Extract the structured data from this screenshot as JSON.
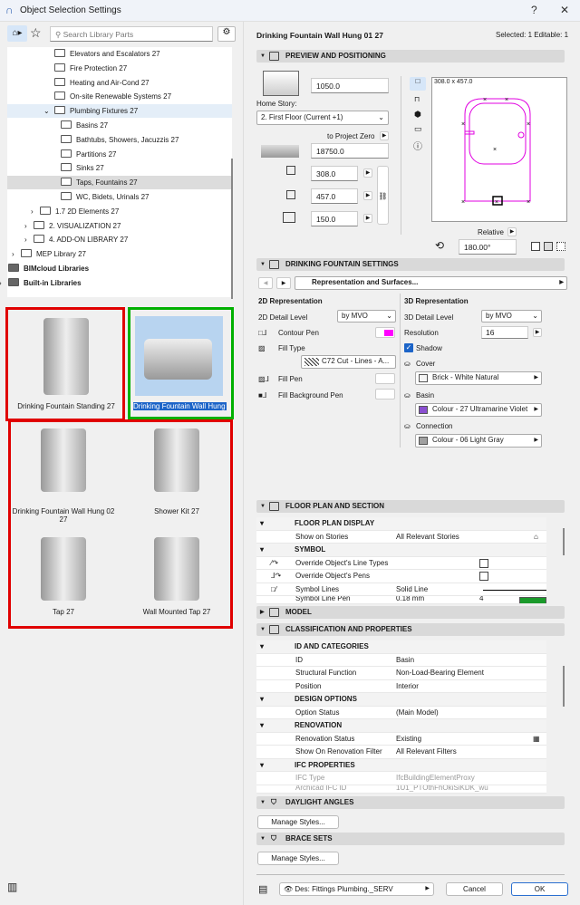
{
  "window": {
    "title": "Object Selection Settings",
    "help": "?",
    "close": "✕"
  },
  "search": {
    "placeholder": "Search Library Parts"
  },
  "tree": [
    {
      "label": "Elevators and Escalators 27",
      "level": 3
    },
    {
      "label": "Fire Protection 27",
      "level": 3
    },
    {
      "label": "Heating and Air-Cond 27",
      "level": 3
    },
    {
      "label": "On-site Renewable Systems 27",
      "level": 3
    },
    {
      "label": "Plumbing Fixtures 27",
      "level": 3,
      "expanded": true,
      "selected": true
    },
    {
      "label": "Basins 27",
      "level": 4
    },
    {
      "label": "Bathtubs, Showers, Jacuzzis 27",
      "level": 4
    },
    {
      "label": "Partitions 27",
      "level": 4
    },
    {
      "label": "Sinks 27",
      "level": 4
    },
    {
      "label": "Taps, Fountains 27",
      "level": 4,
      "highlighted": true
    },
    {
      "label": "WC, Bidets, Urinals 27",
      "level": 4
    },
    {
      "label": "1.7 2D Elements 27",
      "level": 2,
      "collapsed": true
    },
    {
      "label": "2. VISUALIZATION 27",
      "level": 1,
      "collapsed": true
    },
    {
      "label": "4. ADD-ON LIBRARY 27",
      "level": 1,
      "collapsed": true
    },
    {
      "label": "MEP Library 27",
      "level": 0,
      "collapsed": true
    },
    {
      "label": "BIMcloud Libraries",
      "level": -1,
      "bold": true
    },
    {
      "label": "Built-in Libraries",
      "level": -1,
      "bold": true,
      "collapsed": true
    }
  ],
  "thumbnails": [
    {
      "label": "Drinking Fountain Standing 27",
      "box": "#e00000"
    },
    {
      "label": "Drinking Fountain Wall Hung 01 27",
      "selected": true,
      "box": "#00b000"
    },
    {
      "label": "Drinking Fountain Wall Hung 02 27",
      "box": "#e00000"
    },
    {
      "label": "Shower Kit 27"
    },
    {
      "label": "Tap 27"
    },
    {
      "label": "Wall Mounted Tap 27"
    }
  ],
  "right": {
    "object_name": "Drinking Fountain Wall Hung 01 27",
    "selected_info": "Selected: 1 Editable: 1",
    "preview": {
      "header": "PREVIEW AND POSITIONING",
      "elevation": "1050.0",
      "home_story_label": "Home Story:",
      "home_story": "2. First Floor (Current +1)",
      "to_project_zero": "to Project Zero",
      "project_zero_value": "18750.0",
      "width": "308.0",
      "depth": "457.0",
      "height": "150.0",
      "preview_size": "308.0 x 457.0",
      "relative": "Relative",
      "angle": "180.00°"
    },
    "fountain": {
      "header": "DRINKING FOUNTAIN SETTINGS",
      "page": "Representation and Surfaces...",
      "rep2d": {
        "title": "2D Representation",
        "detail_label": "2D Detail Level",
        "detail": "by MVO",
        "contour_pen": "Contour Pen",
        "fill_type_label": "Fill Type",
        "fill_type": "C72 Cut - Lines - A...",
        "fill_pen": "Fill Pen",
        "fill_bg_pen": "Fill Background Pen",
        "contour_color": "#ff00ff"
      },
      "rep3d": {
        "title": "3D Representation",
        "detail_label": "3D Detail Level",
        "detail": "by MVO",
        "resolution_label": "Resolution",
        "resolution": "16",
        "shadow": "Shadow",
        "shadow_checked": true,
        "cover_label": "Cover",
        "cover": "Brick - White Natural",
        "cover_color": "#f4f4f4",
        "basin_label": "Basin",
        "basin": "Colour - 27 Ultramarine Violet",
        "basin_color": "#8a4fd0",
        "connection_label": "Connection",
        "connection": "Colour - 06 Light Gray",
        "connection_color": "#a0a0a0"
      }
    },
    "floorplan": {
      "header": "FLOOR PLAN AND SECTION",
      "display": "FLOOR PLAN DISPLAY",
      "show_on_stories_label": "Show on Stories",
      "show_on_stories": "All Relevant Stories",
      "symbol": "SYMBOL",
      "override_lines": "Override Object's Line Types",
      "override_pens": "Override Object's Pens",
      "symbol_lines_label": "Symbol Lines",
      "symbol_lines": "Solid Line",
      "symbol_pen_label": "Symbol Line Pen",
      "symbol_pen": "0.18 mm",
      "symbol_pen_no": "4",
      "symbol_pen_color": "#1a9a2a"
    },
    "model": {
      "header": "MODEL"
    },
    "classification": {
      "header": "CLASSIFICATION AND PROPERTIES",
      "id_cat": "ID AND CATEGORIES",
      "rows1": [
        {
          "k": "ID",
          "v": "Basin"
        },
        {
          "k": "Structural Function",
          "v": "Non-Load-Bearing Element"
        },
        {
          "k": "Position",
          "v": "Interior"
        }
      ],
      "design": "DESIGN OPTIONS",
      "option_status_label": "Option Status",
      "option_status": "(Main Model)",
      "renovation": "RENOVATION",
      "renovation_status_label": "Renovation Status",
      "renovation_status": "Existing",
      "renovation_filter_label": "Show On Renovation Filter",
      "renovation_filter": "All Relevant Filters",
      "ifc": "IFC PROPERTIES",
      "ifc_type_label": "IFC Type",
      "ifc_type": "IfcBuildingElementProxy",
      "ifc_id_label": "Archicad IFC ID",
      "ifc_id": "1U1_PTOthFhOkiSiKDK_wu"
    },
    "daylight": {
      "header": "DAYLIGHT ANGLES",
      "manage": "Manage Styles..."
    },
    "brace": {
      "header": "BRACE SETS",
      "manage": "Manage Styles..."
    },
    "footer": {
      "layer": "Des: Fittings Plumbing._SERV",
      "cancel": "Cancel",
      "ok": "OK"
    }
  }
}
